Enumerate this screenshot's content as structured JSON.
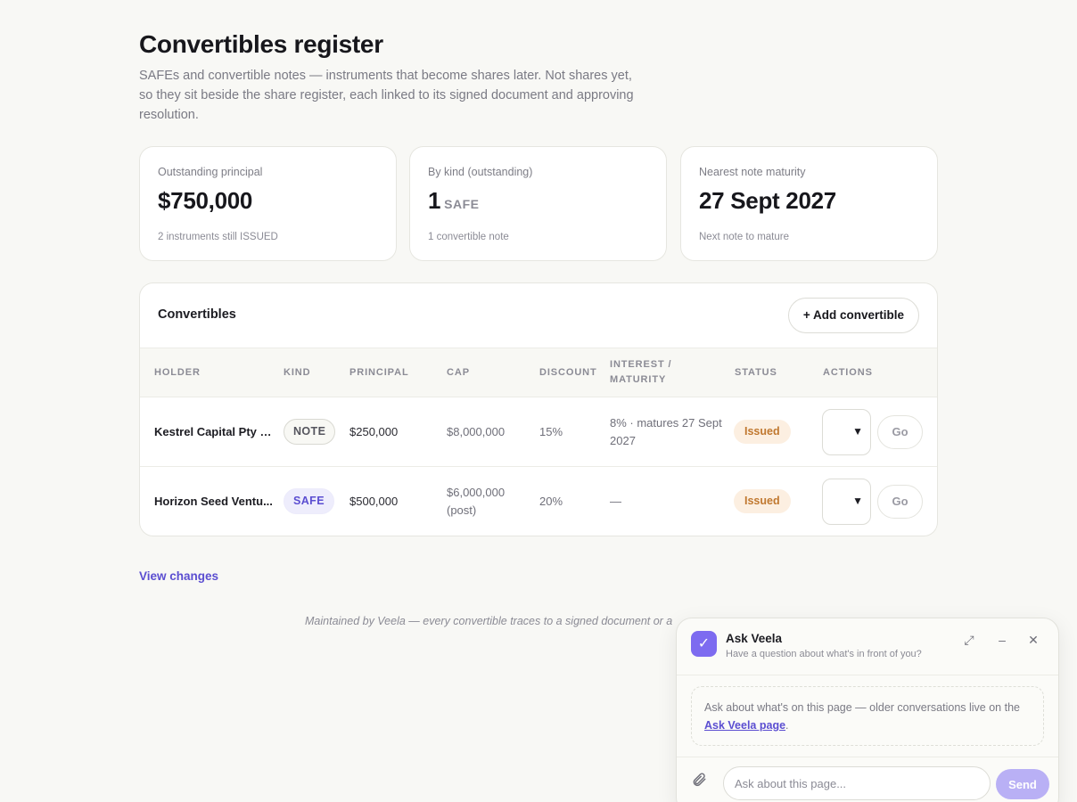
{
  "page": {
    "title": "Convertibles register",
    "subtitle": "SAFEs and convertible notes — instruments that become shares later. Not shares yet, so they sit beside the share register, each linked to its signed document and approving resolution."
  },
  "cards": [
    {
      "label": "Outstanding principal",
      "value": "$750,000",
      "unit": "",
      "sub": "2 instruments still ISSUED"
    },
    {
      "label": "By kind (outstanding)",
      "value": "1",
      "unit": "SAFE",
      "sub": "1 convertible note"
    },
    {
      "label": "Nearest note maturity",
      "value": "27 Sept 2027",
      "unit": "",
      "sub": "Next note to mature"
    }
  ],
  "table": {
    "title": "Convertibles",
    "add_label": "+ Add convertible",
    "columns": [
      "HOLDER",
      "KIND",
      "PRINCIPAL",
      "CAP",
      "DISCOUNT",
      "INTEREST / MATURITY",
      "STATUS",
      "ACTIONS"
    ],
    "rows": [
      {
        "holder": "Kestrel Capital Pty L...",
        "kind": "NOTE",
        "principal": "$250,000",
        "cap": "$8,000,000",
        "discount": "15%",
        "interest": "8% · matures 27 Sept 2027",
        "status": "Issued",
        "go": "Go"
      },
      {
        "holder": "Horizon Seed Ventu...",
        "kind": "SAFE",
        "principal": "$500,000",
        "cap": "$6,000,000 (post)",
        "discount": "20%",
        "interest": "—",
        "status": "Issued",
        "go": "Go"
      }
    ]
  },
  "links": {
    "view_changes": "View changes"
  },
  "footer": {
    "note": "Maintained by Veela — every convertible traces to a signed document or a"
  },
  "chat": {
    "title": "Ask Veela",
    "subtitle": "Have a question about what's in front of you?",
    "hint_prefix": "Ask about what's on this page — older conversations live on the ",
    "hint_link": "Ask Veela page",
    "hint_suffix": ".",
    "input_placeholder": "Ask about this page...",
    "send_label": "Send"
  },
  "colors": {
    "accent": "#5b4ed1",
    "issued_bg": "#fcefe1",
    "issued_text": "#c0782f",
    "logo_bg": "#7d6bf0",
    "send_bg": "#b9b0f5"
  },
  "icons": {
    "logo": "check-icon",
    "expand": "expand-icon",
    "minimize": "minimize-icon",
    "close": "close-icon",
    "attach": "paperclip-icon",
    "select": "chevron-down-icon"
  }
}
